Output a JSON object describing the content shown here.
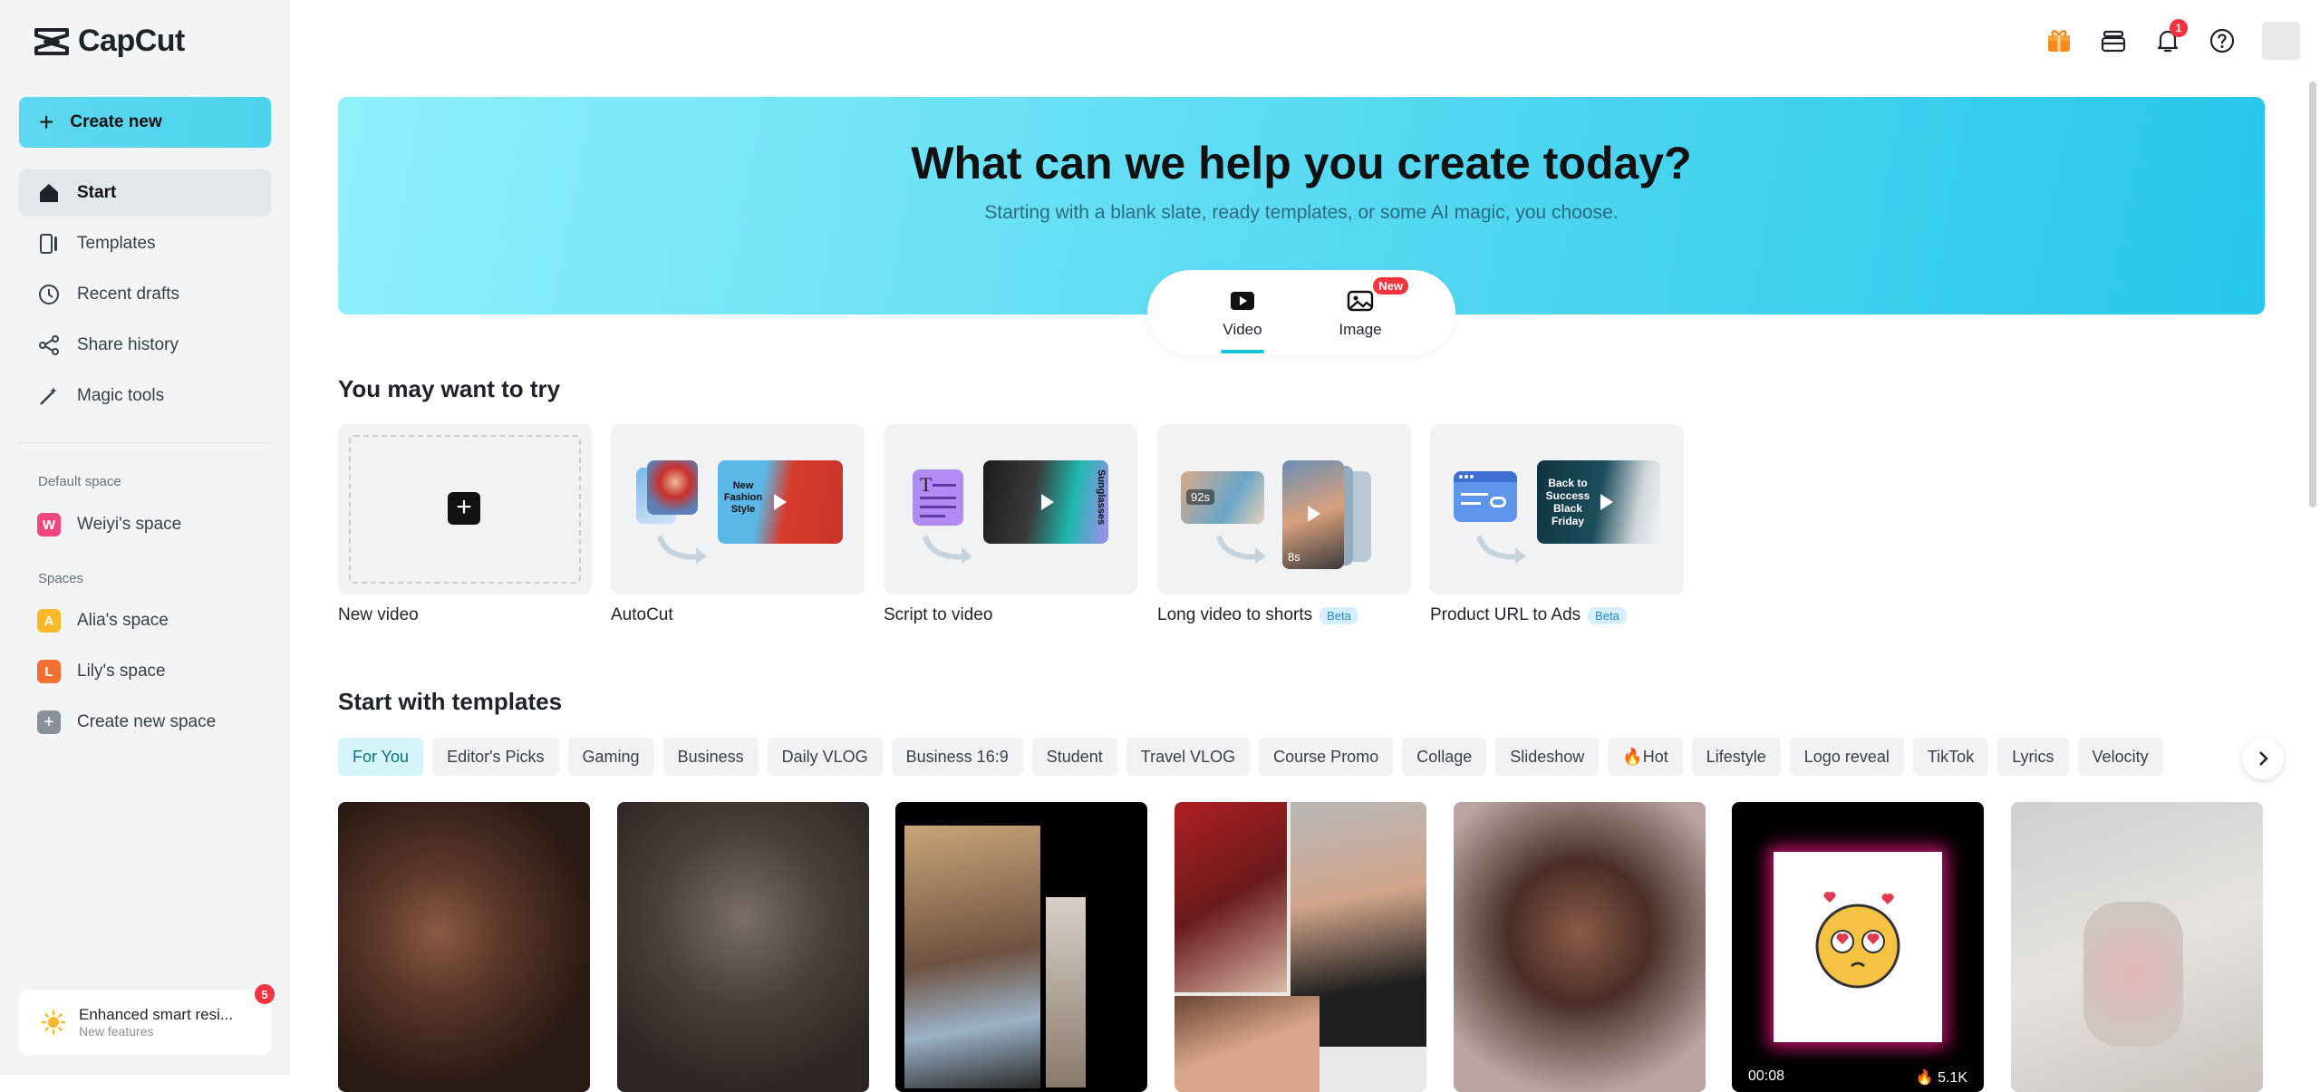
{
  "app": {
    "name": "CapCut"
  },
  "sidebar": {
    "create_label": "Create new",
    "nav": [
      {
        "label": "Start",
        "icon": "home-icon"
      },
      {
        "label": "Templates",
        "icon": "templates-icon"
      },
      {
        "label": "Recent drafts",
        "icon": "clock-icon"
      },
      {
        "label": "Share history",
        "icon": "share-icon"
      },
      {
        "label": "Magic tools",
        "icon": "magic-wand-icon"
      }
    ],
    "default_space_label": "Default space",
    "default_space": {
      "name": "Weiyi's space",
      "initial": "W",
      "color": "#f0457f"
    },
    "spaces_label": "Spaces",
    "spaces": [
      {
        "name": "Alia's space",
        "initial": "A",
        "color": "#f7b928"
      },
      {
        "name": "Lily's space",
        "initial": "L",
        "color": "#f46f32"
      }
    ],
    "create_space_label": "Create new space",
    "promo": {
      "title": "Enhanced smart resi...",
      "subtitle": "New features",
      "badge": "5"
    }
  },
  "topbar": {
    "notification_count": "1"
  },
  "hero": {
    "title": "What can we help you create today?",
    "subtitle": "Starting with a blank slate, ready templates, or some AI magic, you choose.",
    "tabs": [
      {
        "label": "Video",
        "active": true
      },
      {
        "label": "Image",
        "badge": "New"
      }
    ]
  },
  "try": {
    "title": "You may want to try",
    "cards": [
      {
        "label": "New video"
      },
      {
        "label": "AutoCut",
        "thumb_text": "New Fashion Style"
      },
      {
        "label": "Script to video",
        "thumb_text": "Sunglasses"
      },
      {
        "label": "Long video to shorts",
        "badge": "Beta",
        "durations": [
          "92s",
          "8s"
        ]
      },
      {
        "label": "Product URL to Ads",
        "badge": "Beta",
        "thumb_text": "Back to Success Black Friday"
      }
    ]
  },
  "templates": {
    "title": "Start with templates",
    "chips": [
      "For You",
      "Editor's Picks",
      "Gaming",
      "Business",
      "Daily VLOG",
      "Business 16:9",
      "Student",
      "Travel VLOG",
      "Course Promo",
      "Collage",
      "Slideshow",
      "🔥Hot",
      "Lifestyle",
      "Logo reveal",
      "TikTok",
      "Lyrics",
      "Velocity"
    ],
    "items": [
      {
        "duration": "",
        "likes": ""
      },
      {
        "duration": "",
        "likes": ""
      },
      {
        "duration": "",
        "likes": ""
      },
      {
        "duration": "",
        "likes": ""
      },
      {
        "duration": "",
        "likes": ""
      },
      {
        "duration": "00:08",
        "likes": "5.1K"
      },
      {
        "duration": "",
        "likes": ""
      }
    ]
  }
}
